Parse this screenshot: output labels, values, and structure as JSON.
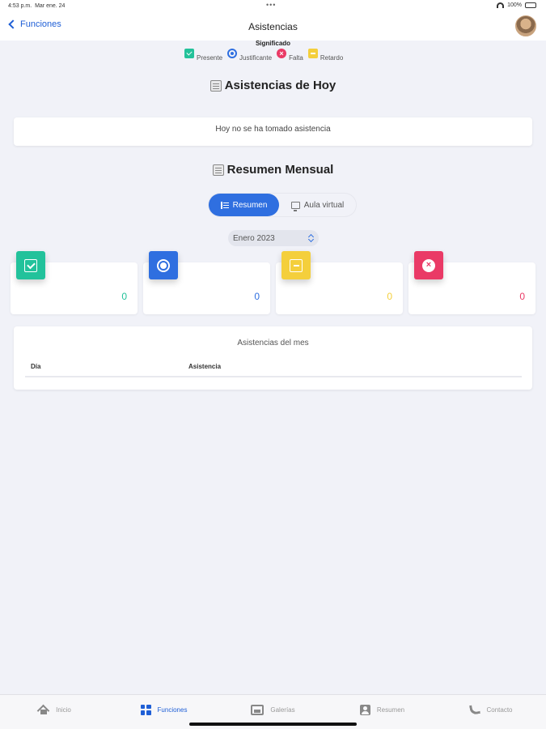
{
  "status_bar": {
    "time": "4:53 p.m.",
    "date": "Mar ene. 24",
    "dots": "•••",
    "battery": "100%"
  },
  "nav": {
    "back_label": "Funciones",
    "title": "Asistencias"
  },
  "legend": {
    "title": "Significado",
    "items": [
      {
        "label": "Presente",
        "icon": "check-icon",
        "color": "#23c29a"
      },
      {
        "label": "Justificante",
        "icon": "radio-icon",
        "color": "#2f6fe0"
      },
      {
        "label": "Falta",
        "icon": "x-icon",
        "color": "#ea3a66"
      },
      {
        "label": "Retardo",
        "icon": "dash-icon",
        "color": "#f4cf3c"
      }
    ]
  },
  "today": {
    "heading": "Asistencias de Hoy",
    "empty_message": "Hoy no se ha tomado asistencia"
  },
  "monthly": {
    "heading": "Resumen Mensual",
    "segments": [
      {
        "label": "Resumen",
        "active": true
      },
      {
        "label": "Aula virtual",
        "active": false
      }
    ],
    "month_select": "Enero 2023",
    "stats": [
      {
        "name": "presente",
        "value": "0",
        "color": "#23c29a"
      },
      {
        "name": "justificante",
        "value": "0",
        "color": "#2f6fe0"
      },
      {
        "name": "retardo",
        "value": "0",
        "color": "#f4cf3c"
      },
      {
        "name": "falta",
        "value": "0",
        "color": "#ea3a66"
      }
    ],
    "table": {
      "title": "Asistencias del mes",
      "columns": [
        "Día",
        "Asistencia"
      ]
    }
  },
  "tab_bar": {
    "items": [
      {
        "label": "Inicio",
        "icon": "home-icon",
        "active": false
      },
      {
        "label": "Funciones",
        "icon": "grid-icon",
        "active": true
      },
      {
        "label": "Galerías",
        "icon": "photo-icon",
        "active": false
      },
      {
        "label": "Resumen",
        "icon": "person-card-icon",
        "active": false
      },
      {
        "label": "Contacto",
        "icon": "phone-icon",
        "active": false
      }
    ]
  }
}
